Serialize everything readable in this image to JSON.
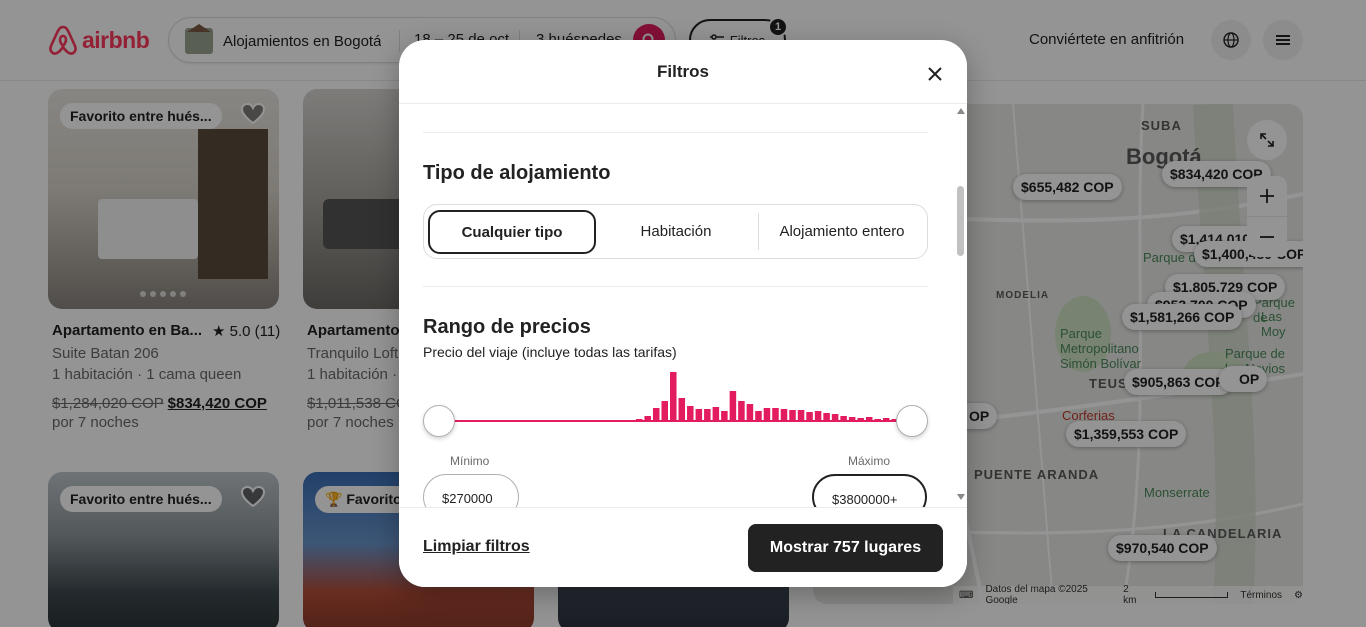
{
  "header": {
    "logo_text": "airbnb",
    "search": {
      "location": "Alojamientos en Bogotá",
      "dates": "18 – 25 de oct.",
      "guests": "3 huéspedes"
    },
    "filters_label": "Filtros",
    "filters_count": "1",
    "host_link": "Conviértete en anfitrión"
  },
  "listings": [
    {
      "badge": "Favorito entre hués...",
      "title": "Apartamento en Ba...",
      "rating": "★ 5.0 (11)",
      "subtitle": "Suite Batan 206",
      "details": "1 habitación · 1 cama queen",
      "original_price": "$1,284,020 COP",
      "price": "$834,420 COP",
      "nights": "por 7 noches"
    },
    {
      "badge": "",
      "title": "Apartamento",
      "rating": "",
      "subtitle": "Tranquilo Loft",
      "details": "1 habitación ·",
      "original_price": "$1,011,538 COP",
      "price": "",
      "nights": "por 7 noches"
    },
    {
      "badge": "Favorito entre hués...",
      "title": "",
      "rating": "",
      "subtitle": "",
      "details": "",
      "original_price": "",
      "price": "",
      "nights": ""
    },
    {
      "badge": "Favorito",
      "title": "",
      "rating": "",
      "subtitle": "",
      "details": "",
      "original_price": "",
      "price": "",
      "nights": ""
    }
  ],
  "map": {
    "labels": [
      "SUBA",
      "Bogotá",
      "MODELIA",
      "TEUSAQUILLO",
      "PUENTE ARANDA",
      "LA CANDELARIA"
    ],
    "areas": [
      "Parque de",
      "Parque Metropolitano Simón Bolívar",
      "Corferias",
      "Monserrate",
      "Parque de los Novios",
      "Las Moy",
      "Parque de"
    ],
    "pins": [
      "$655,482 COP",
      "$834,420 COP",
      "$1,414,010",
      "$1,400,480 COP",
      "$1,805,729 COP",
      "$953,700 COP",
      "$1,581,266 COP",
      "$905,863 COP",
      "$1,359,553 COP",
      "$970,540 COP",
      "OP",
      "OP"
    ],
    "footer": {
      "data": "Datos del mapa ©2025 Google",
      "scale": "2 km",
      "terms": "Términos"
    }
  },
  "modal": {
    "title": "Filtros",
    "property_type": {
      "title": "Tipo de alojamiento",
      "options": [
        "Cualquier tipo",
        "Habitación",
        "Alojamiento entero"
      ],
      "selected": "Cualquier tipo"
    },
    "price_range": {
      "title": "Rango de precios",
      "subtitle": "Precio del viaje (incluye todas las tarifas)",
      "min_label": "Mínimo",
      "max_label": "Máximo",
      "min_value": "$270000",
      "max_value": "$3800000+",
      "histogram": [
        0.02,
        0.02,
        0.02,
        0.02,
        0.02,
        0.02,
        0.02,
        0.02,
        0.02,
        0.02,
        0.02,
        0.02,
        0.02,
        0.02,
        0.02,
        0.02,
        0.02,
        0.02,
        0.02,
        0.02,
        0.02,
        0.02,
        0.04,
        0.06,
        0.12,
        0.28,
        0.42,
        1.0,
        0.48,
        0.32,
        0.26,
        0.26,
        0.3,
        0.22,
        0.62,
        0.42,
        0.36,
        0.22,
        0.28,
        0.28,
        0.26,
        0.24,
        0.24,
        0.2,
        0.22,
        0.18,
        0.16,
        0.12,
        0.1,
        0.08,
        0.1,
        0.06,
        0.08,
        0.06
      ]
    },
    "footer": {
      "clear_label": "Limpiar filtros",
      "show_label": "Mostrar 757 lugares"
    }
  }
}
